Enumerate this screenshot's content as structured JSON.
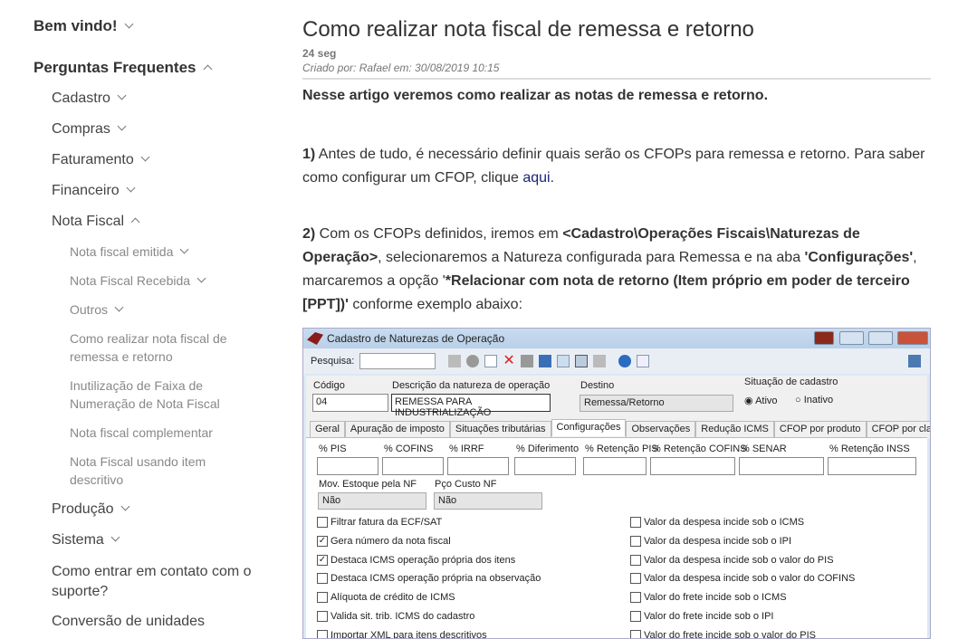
{
  "sidebar": {
    "welcome": "Bem vindo!",
    "faq": "Perguntas Frequentes",
    "items": [
      "Cadastro",
      "Compras",
      "Faturamento",
      "Financeiro",
      "Nota Fiscal"
    ],
    "nf_items": [
      "Nota fiscal emitida",
      "Nota Fiscal Recebida",
      "Outros"
    ],
    "articles": [
      "Como realizar nota fiscal de remessa e retorno",
      "Inutilização de Faixa de Numeração de Nota Fiscal",
      "Nota fiscal complementar",
      "Nota Fiscal usando item descritivo"
    ],
    "after": [
      "Produção",
      "Sistema",
      "Como entrar em contato com o suporte?",
      "Conversão de unidades"
    ]
  },
  "article": {
    "title": "Como realizar nota fiscal de remessa e retorno",
    "duration": "24 seg",
    "meta": "Criado por: Rafael em: 30/08/2019 10:15",
    "intro": "Nesse artigo veremos como realizar as notas de remessa e retorno.",
    "s1_num": "1)",
    "s1_text": " Antes de tudo, é necessário definir quais serão os CFOPs para remessa e retorno. Para saber como configurar um CFOP, clique ",
    "s1_link": "aqui",
    "s1_end": ".",
    "s2_num": "2)",
    "s2_a": " Com os CFOPs definidos, iremos em ",
    "s2_path": "<Cadastro\\Operações Fiscais\\Naturezas de Operação>",
    "s2_b": ", selecionaremos a Natureza configurada para Remessa e na aba ",
    "s2_tab": "'Configurações'",
    "s2_c": ", marcaremos a opção '",
    "s2_opt": "*Relacionar com nota de retorno (Item próprio em poder de terceiro [PPT])'",
    "s2_d": " conforme exemplo abaixo:"
  },
  "window": {
    "title": "Cadastro de Naturezas de Operação",
    "search_label": "Pesquisa:",
    "codigo_label": "Código",
    "codigo": "04",
    "desc_label": "Descrição da natureza de operação",
    "desc": "REMESSA PARA INDUSTRIALIZAÇÃO",
    "destino_label": "Destino",
    "destino": "Remessa/Retorno",
    "situacao_label": "Situação de cadastro",
    "ativo": "Ativo",
    "inativo": "Inativo",
    "tabs": [
      "Geral",
      "Apuração de imposto",
      "Situações tributárias",
      "Configurações",
      "Observações",
      "Redução ICMS",
      "CFOP por produto",
      "CFOP por classificaç"
    ],
    "pct_fields": [
      "% PIS",
      "% COFINS",
      "% IRRF",
      "% Diferimento",
      "% Retenção PIS",
      "% Retenção COFINS",
      "% SENAR",
      "% Retenção INSS"
    ],
    "mov_label": "Mov. Estoque pela NF",
    "mov": "Não",
    "pco_label": "Pço Custo NF",
    "pco": "Não",
    "left_checks": [
      {
        "label": "Filtrar fatura da ECF/SAT",
        "checked": false
      },
      {
        "label": "Gera número da nota fiscal",
        "checked": true
      },
      {
        "label": "Destaca ICMS operação própria dos itens",
        "checked": true
      },
      {
        "label": "Destaca ICMS operação própria na observação",
        "checked": false
      },
      {
        "label": "Alíquota de crédito de ICMS",
        "checked": false
      },
      {
        "label": "Valida sit. trib. ICMS do cadastro",
        "checked": false
      },
      {
        "label": "Importar XML para itens descritivos",
        "checked": false
      }
    ],
    "right_checks": [
      {
        "label": "Valor da despesa incide sob o ICMS",
        "checked": false
      },
      {
        "label": "Valor da despesa incide sob o IPI",
        "checked": false
      },
      {
        "label": "Valor da despesa incide sob o valor do PIS",
        "checked": false
      },
      {
        "label": "Valor da despesa incide sob o valor do COFINS",
        "checked": false
      },
      {
        "label": "Valor do frete incide sob o ICMS",
        "checked": false
      },
      {
        "label": "Valor do frete incide sob o IPI",
        "checked": false
      },
      {
        "label": "Valor do frete incide sob o valor do PIS",
        "checked": false
      }
    ]
  }
}
